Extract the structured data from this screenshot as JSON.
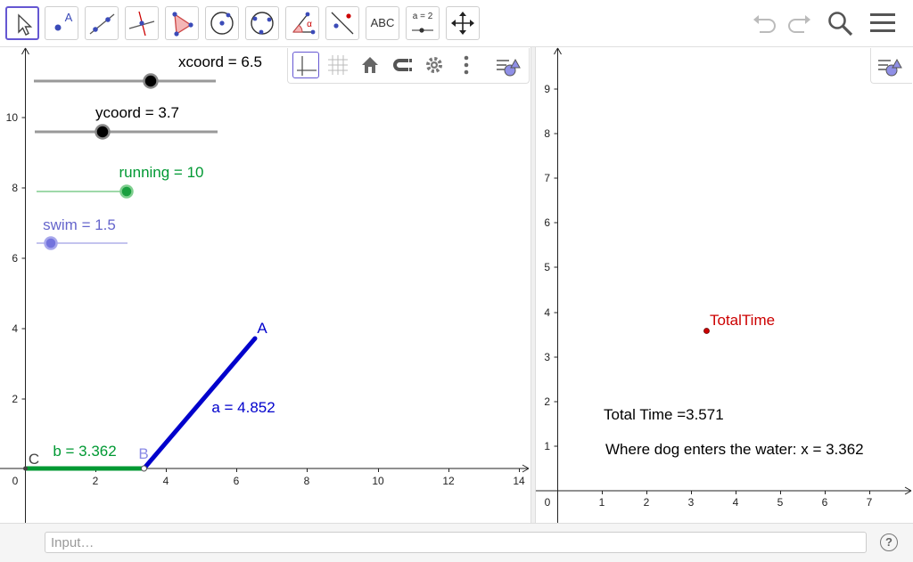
{
  "toolbar": {
    "tools": [
      {
        "name": "move-tool",
        "label": ""
      },
      {
        "name": "point-tool",
        "label": "A"
      },
      {
        "name": "line-tool",
        "label": ""
      },
      {
        "name": "perpendicular-line-tool",
        "label": ""
      },
      {
        "name": "polygon-tool",
        "label": ""
      },
      {
        "name": "circle-with-center-tool",
        "label": ""
      },
      {
        "name": "circle-through-points-tool",
        "label": ""
      },
      {
        "name": "angle-tool",
        "label": "α"
      },
      {
        "name": "reflect-tool",
        "label": ""
      },
      {
        "name": "text-tool",
        "label": "ABC"
      },
      {
        "name": "slider-tool",
        "label": "a = 2"
      },
      {
        "name": "move-view-tool",
        "label": ""
      }
    ]
  },
  "graphics1": {
    "sliders": [
      {
        "label": "xcoord = 6.5",
        "value": 6.5,
        "color": "#000000"
      },
      {
        "label": "ycoord = 3.7",
        "value": 3.7,
        "color": "#000000"
      },
      {
        "label": "running = 10",
        "value": 10,
        "color": "#009933"
      },
      {
        "label": "swim = 1.5",
        "value": 1.5,
        "color": "#6666cc"
      }
    ],
    "x_ticks": [
      "0",
      "2",
      "4",
      "6",
      "8",
      "10",
      "12",
      "14"
    ],
    "y_ticks": [
      "2",
      "4",
      "6",
      "8",
      "10"
    ],
    "points": {
      "A": "A",
      "B": "B",
      "C": "C"
    },
    "segments": {
      "a": "a = 4.852",
      "b": "b = 3.362"
    },
    "colors": {
      "segment_a": "#0000cc",
      "segment_b": "#009933",
      "point_b": "#8a8ae6"
    }
  },
  "graphics2": {
    "x_ticks": [
      "0",
      "1",
      "2",
      "3",
      "4",
      "5",
      "6",
      "7"
    ],
    "y_ticks": [
      "1",
      "2",
      "3",
      "4",
      "5",
      "6",
      "7",
      "8",
      "9"
    ],
    "point_label": "TotalTime",
    "point_color": "#cc0000",
    "text_total_time": "Total Time =3.571",
    "text_enters_water": "Where dog enters the water:  x = 3.362"
  },
  "input_bar": {
    "placeholder": "Input…",
    "help": "?"
  }
}
